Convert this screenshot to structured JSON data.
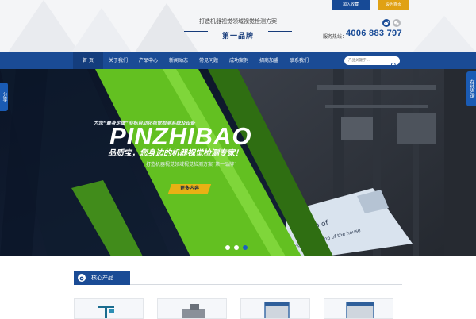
{
  "header": {
    "slogan": "打造机器视觉领域视觉检测方案",
    "brand": "第一品牌",
    "join_label": "加入收藏",
    "fav_label": "设为首页",
    "hotline_label": "服务热线：",
    "hotline": "4006 883 797",
    "icons": [
      "weibo-icon",
      "wechat-icon"
    ]
  },
  "nav": {
    "items": [
      "首 页",
      "关于我们",
      "产品中心",
      "新闻动态",
      "常见问题",
      "成功案例",
      "招商加盟",
      "联系我们"
    ],
    "active_index": 0,
    "search_placeholder": "产品关键字..."
  },
  "banner": {
    "tagline": "为您“量身定做”非标自动化视觉检测系统及设备",
    "brand_en": "PINZHIBAO",
    "headline": "品质宝，您身边的机器视觉检测专家！",
    "subline": "打造机器视觉领域视觉检测方案“第一品牌”",
    "more_label": "更多内容",
    "slides": 3,
    "active_slide": 2,
    "photo_text_1": "on top of",
    "photo_text_2": "mouse is on top of the house"
  },
  "side": {
    "share_label": "分享",
    "consult_label": "在线咨询"
  },
  "products": {
    "title": "核心产品",
    "items": [
      "product-1",
      "product-2",
      "product-3",
      "product-4"
    ]
  },
  "colors": {
    "nav_blue": "#1a4b95",
    "accent_green": "#63c021",
    "accent_yellow": "#e9b114"
  }
}
